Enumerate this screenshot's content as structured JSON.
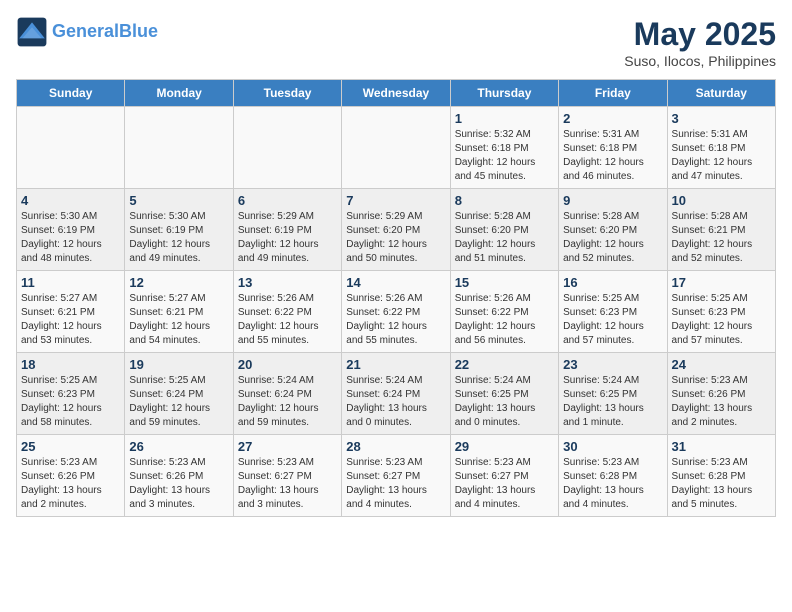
{
  "header": {
    "logo_line1": "General",
    "logo_line2": "Blue",
    "month": "May 2025",
    "location": "Suso, Ilocos, Philippines"
  },
  "weekdays": [
    "Sunday",
    "Monday",
    "Tuesday",
    "Wednesday",
    "Thursday",
    "Friday",
    "Saturday"
  ],
  "weeks": [
    [
      {
        "day": "",
        "info": ""
      },
      {
        "day": "",
        "info": ""
      },
      {
        "day": "",
        "info": ""
      },
      {
        "day": "",
        "info": ""
      },
      {
        "day": "1",
        "info": "Sunrise: 5:32 AM\nSunset: 6:18 PM\nDaylight: 12 hours\nand 45 minutes."
      },
      {
        "day": "2",
        "info": "Sunrise: 5:31 AM\nSunset: 6:18 PM\nDaylight: 12 hours\nand 46 minutes."
      },
      {
        "day": "3",
        "info": "Sunrise: 5:31 AM\nSunset: 6:18 PM\nDaylight: 12 hours\nand 47 minutes."
      }
    ],
    [
      {
        "day": "4",
        "info": "Sunrise: 5:30 AM\nSunset: 6:19 PM\nDaylight: 12 hours\nand 48 minutes."
      },
      {
        "day": "5",
        "info": "Sunrise: 5:30 AM\nSunset: 6:19 PM\nDaylight: 12 hours\nand 49 minutes."
      },
      {
        "day": "6",
        "info": "Sunrise: 5:29 AM\nSunset: 6:19 PM\nDaylight: 12 hours\nand 49 minutes."
      },
      {
        "day": "7",
        "info": "Sunrise: 5:29 AM\nSunset: 6:20 PM\nDaylight: 12 hours\nand 50 minutes."
      },
      {
        "day": "8",
        "info": "Sunrise: 5:28 AM\nSunset: 6:20 PM\nDaylight: 12 hours\nand 51 minutes."
      },
      {
        "day": "9",
        "info": "Sunrise: 5:28 AM\nSunset: 6:20 PM\nDaylight: 12 hours\nand 52 minutes."
      },
      {
        "day": "10",
        "info": "Sunrise: 5:28 AM\nSunset: 6:21 PM\nDaylight: 12 hours\nand 52 minutes."
      }
    ],
    [
      {
        "day": "11",
        "info": "Sunrise: 5:27 AM\nSunset: 6:21 PM\nDaylight: 12 hours\nand 53 minutes."
      },
      {
        "day": "12",
        "info": "Sunrise: 5:27 AM\nSunset: 6:21 PM\nDaylight: 12 hours\nand 54 minutes."
      },
      {
        "day": "13",
        "info": "Sunrise: 5:26 AM\nSunset: 6:22 PM\nDaylight: 12 hours\nand 55 minutes."
      },
      {
        "day": "14",
        "info": "Sunrise: 5:26 AM\nSunset: 6:22 PM\nDaylight: 12 hours\nand 55 minutes."
      },
      {
        "day": "15",
        "info": "Sunrise: 5:26 AM\nSunset: 6:22 PM\nDaylight: 12 hours\nand 56 minutes."
      },
      {
        "day": "16",
        "info": "Sunrise: 5:25 AM\nSunset: 6:23 PM\nDaylight: 12 hours\nand 57 minutes."
      },
      {
        "day": "17",
        "info": "Sunrise: 5:25 AM\nSunset: 6:23 PM\nDaylight: 12 hours\nand 57 minutes."
      }
    ],
    [
      {
        "day": "18",
        "info": "Sunrise: 5:25 AM\nSunset: 6:23 PM\nDaylight: 12 hours\nand 58 minutes."
      },
      {
        "day": "19",
        "info": "Sunrise: 5:25 AM\nSunset: 6:24 PM\nDaylight: 12 hours\nand 59 minutes."
      },
      {
        "day": "20",
        "info": "Sunrise: 5:24 AM\nSunset: 6:24 PM\nDaylight: 12 hours\nand 59 minutes."
      },
      {
        "day": "21",
        "info": "Sunrise: 5:24 AM\nSunset: 6:24 PM\nDaylight: 13 hours\nand 0 minutes."
      },
      {
        "day": "22",
        "info": "Sunrise: 5:24 AM\nSunset: 6:25 PM\nDaylight: 13 hours\nand 0 minutes."
      },
      {
        "day": "23",
        "info": "Sunrise: 5:24 AM\nSunset: 6:25 PM\nDaylight: 13 hours\nand 1 minute."
      },
      {
        "day": "24",
        "info": "Sunrise: 5:23 AM\nSunset: 6:26 PM\nDaylight: 13 hours\nand 2 minutes."
      }
    ],
    [
      {
        "day": "25",
        "info": "Sunrise: 5:23 AM\nSunset: 6:26 PM\nDaylight: 13 hours\nand 2 minutes."
      },
      {
        "day": "26",
        "info": "Sunrise: 5:23 AM\nSunset: 6:26 PM\nDaylight: 13 hours\nand 3 minutes."
      },
      {
        "day": "27",
        "info": "Sunrise: 5:23 AM\nSunset: 6:27 PM\nDaylight: 13 hours\nand 3 minutes."
      },
      {
        "day": "28",
        "info": "Sunrise: 5:23 AM\nSunset: 6:27 PM\nDaylight: 13 hours\nand 4 minutes."
      },
      {
        "day": "29",
        "info": "Sunrise: 5:23 AM\nSunset: 6:27 PM\nDaylight: 13 hours\nand 4 minutes."
      },
      {
        "day": "30",
        "info": "Sunrise: 5:23 AM\nSunset: 6:28 PM\nDaylight: 13 hours\nand 4 minutes."
      },
      {
        "day": "31",
        "info": "Sunrise: 5:23 AM\nSunset: 6:28 PM\nDaylight: 13 hours\nand 5 minutes."
      }
    ]
  ]
}
